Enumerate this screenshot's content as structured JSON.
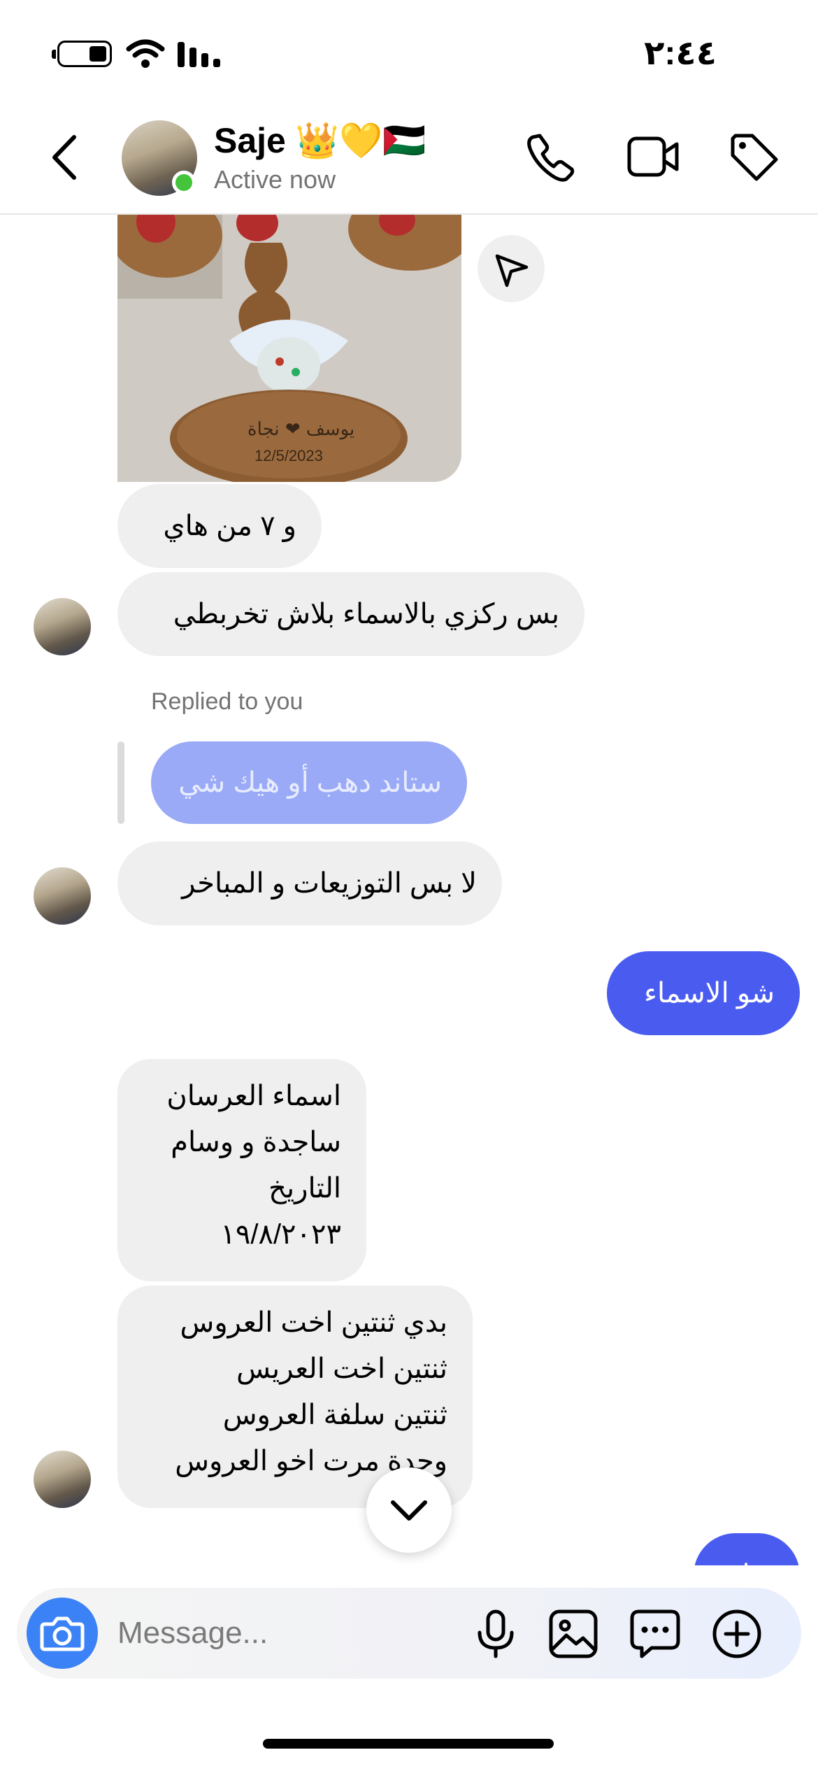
{
  "status_bar": {
    "time": "٢:٤٤"
  },
  "header": {
    "contact_name": "Saje 👑💛🇵🇸",
    "status": "Active now",
    "icons": [
      "back-icon",
      "phone-icon",
      "video-icon",
      "tag-icon"
    ]
  },
  "messages": {
    "m1": "و ٧ من هاي",
    "m2": "بس ركزي بالاسماء بلاش تخربطي",
    "replied_label": "Replied to you",
    "quoted": "ستاند دهب أو هيك شي",
    "m3": "لا بس التوزيعات و المباخر",
    "out1": "شو الاسماء",
    "m4_lines": [
      "اسماء العرسان",
      "ساجدة و وسام",
      "التاريخ",
      "١٩/٨/٢٠٢٣"
    ],
    "m5_lines": [
      "بدي ثنتين اخت العروس",
      "ثنتين اخت العريس",
      "ثنتين سلفة العروس",
      "وحدة مرت اخو العروس"
    ],
    "out2": "تمام"
  },
  "photo": {
    "date": "12/5/2023",
    "names": "يوسف ❤ نجاة"
  },
  "composer": {
    "placeholder": "Message..."
  },
  "colors": {
    "accent": "#4a5cf0",
    "incoming": "#efefef",
    "online": "#43c43a",
    "camera": "#3b82f6"
  }
}
